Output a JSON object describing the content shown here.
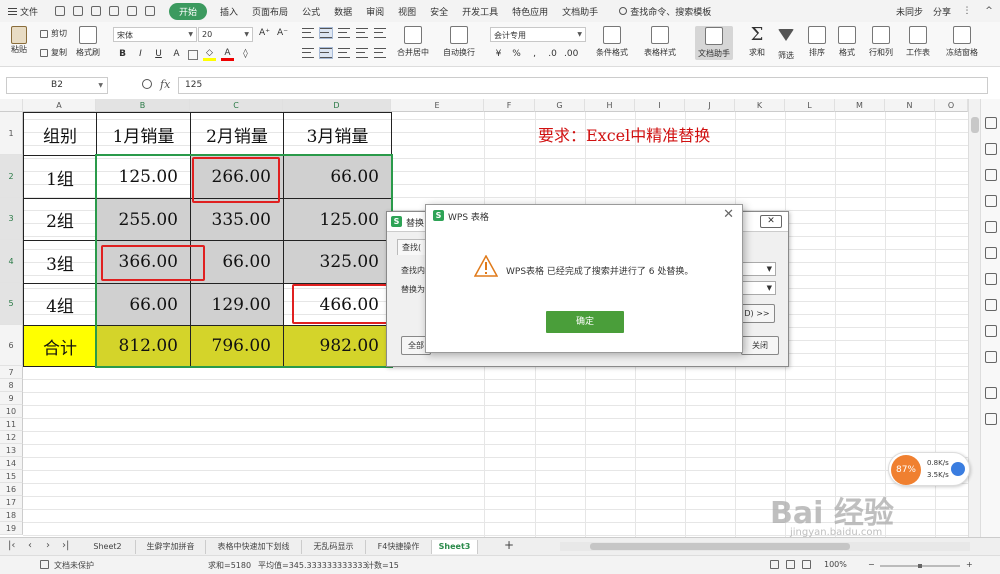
{
  "menu": {
    "file": "文件",
    "tabs": [
      "开始",
      "插入",
      "页面布局",
      "公式",
      "数据",
      "审阅",
      "视图",
      "安全",
      "开发工具",
      "特色应用",
      "文档助手"
    ],
    "search": "查找命令、搜索模板",
    "sync": "未同步",
    "share": "分享"
  },
  "ribbon": {
    "paste": "粘贴",
    "cut": "剪切",
    "copy": "复制",
    "format_painter": "格式刷",
    "font": "宋体",
    "size": "20",
    "merge": "合并居中",
    "wrap": "自动换行",
    "numfmt": "会计专用",
    "cond_fmt": "条件格式",
    "table_style": "表格样式",
    "doc_helper": "文档助手",
    "sum": "求和",
    "filter": "筛选",
    "sort": "排序",
    "format": "格式",
    "rowcol": "行和列",
    "sheet": "工作表",
    "freeze": "冻结窗格"
  },
  "formula_bar": {
    "cell_ref": "B2",
    "fx": "fx",
    "value": "125"
  },
  "columns": [
    "A",
    "B",
    "C",
    "D",
    "E",
    "F",
    "G",
    "H",
    "I",
    "J",
    "K",
    "L",
    "M",
    "N",
    "O"
  ],
  "rows": [
    "1",
    "2",
    "3",
    "4",
    "5",
    "6",
    "7",
    "8",
    "9",
    "10",
    "11",
    "12",
    "13",
    "14",
    "15",
    "16",
    "17",
    "18",
    "19",
    "20",
    "21",
    "22",
    "23",
    "24",
    "25",
    "26",
    "27"
  ],
  "table": {
    "header": [
      "组别",
      "1月销量",
      "2月销量",
      "3月销量"
    ],
    "rows": [
      [
        "1组",
        "125.00",
        "266.00",
        "66.00"
      ],
      [
        "2组",
        "255.00",
        "335.00",
        "125.00"
      ],
      [
        "3组",
        "366.00",
        "66.00",
        "325.00"
      ],
      [
        "4组",
        "66.00",
        "129.00",
        "466.00"
      ]
    ],
    "total": [
      "合计",
      "812.00",
      "796.00",
      "982.00"
    ]
  },
  "note": "要求：Excel中精准替换",
  "replace_dialog": {
    "title": "替换",
    "tab": "查找(",
    "find_label": "查找内",
    "replace_label": "替换为",
    "options": "D) >>",
    "replace_all": "全部",
    "close": "关闭"
  },
  "message_dialog": {
    "title": "WPS 表格",
    "message": "WPS表格 已经完成了搜索并进行了 6 处替换。",
    "ok": "确定"
  },
  "sheet_tabs": [
    "Sheet2",
    "生僻字加拼音",
    "表格中快速加下划线",
    "无乱码显示",
    "F4快捷操作",
    "Sheet3"
  ],
  "active_sheet": "Sheet3",
  "status": {
    "protect": "文档未保护",
    "sum": "求和=5180",
    "avg": "平均值=345.333333333333",
    "count": "计数=15",
    "zoom": "100%"
  },
  "speed_widget": {
    "percent": "87%",
    "up": "0.8K/s",
    "down": "3.5K/s"
  },
  "watermark": {
    "main": "Bai 经验",
    "url": "jingyan.baidu.com"
  },
  "colors": {
    "accent": "#3c9a5f",
    "yellow": "#ffff00",
    "olive": "#d4d42a",
    "red": "#e02020",
    "ok": "#4a9e3a"
  }
}
